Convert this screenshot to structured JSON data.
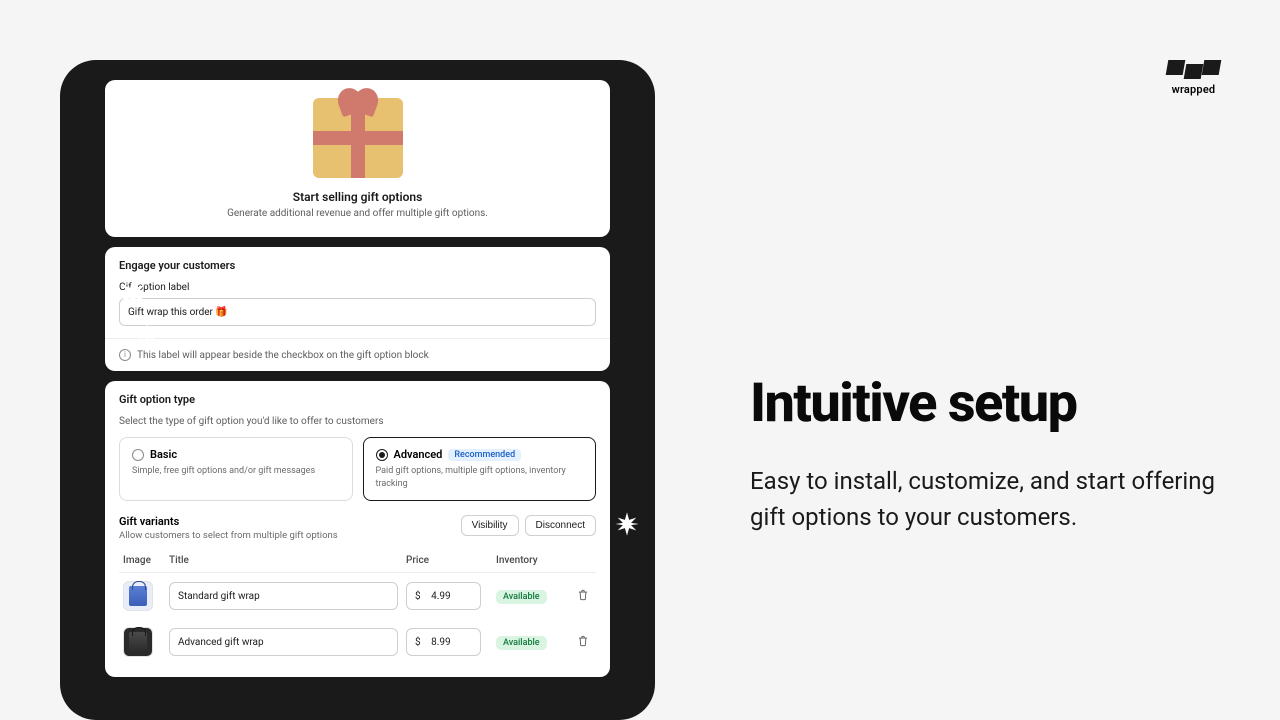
{
  "brand": {
    "name": "wrapped"
  },
  "hero": {
    "title": "Start selling gift options",
    "subtitle": "Generate additional revenue and offer multiple gift options."
  },
  "engage": {
    "section_title": "Engage your customers",
    "field_label": "Gift option label",
    "input_value": "Gift wrap this order 🎁",
    "helper": "This label will appear beside the checkbox on the gift option block"
  },
  "type": {
    "section_title": "Gift option type",
    "sub_desc": "Select the type of gift option you'd like to offer to customers",
    "basic": {
      "title": "Basic",
      "desc": "Simple, free gift options and/or gift messages"
    },
    "advanced": {
      "title": "Advanced",
      "rec": "Recommended",
      "desc": "Paid gift options, multiple gift options, inventory tracking"
    }
  },
  "variants": {
    "title": "Gift variants",
    "sub": "Allow customers to select from multiple gift options",
    "visibility_btn": "Visibility",
    "disconnect_btn": "Disconnect",
    "columns": {
      "image": "Image",
      "title": "Title",
      "price": "Price",
      "inventory": "Inventory"
    },
    "currency": "$",
    "rows": [
      {
        "title": "Standard gift wrap",
        "price": "4.99",
        "inventory": "Available"
      },
      {
        "title": "Advanced gift wrap",
        "price": "8.99",
        "inventory": "Available"
      }
    ]
  },
  "marketing": {
    "headline": "Intuitive setup",
    "body": "Easy to install, customize, and start offering gift options to your customers."
  }
}
